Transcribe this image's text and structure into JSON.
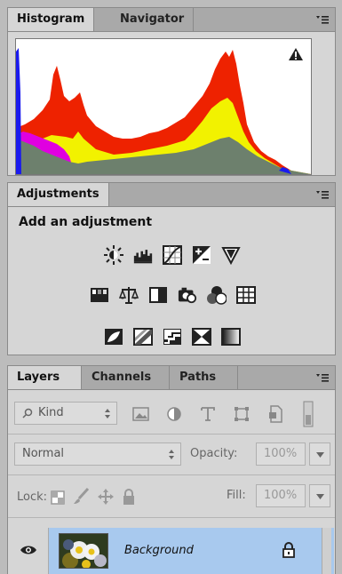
{
  "histogram_panel": {
    "tabs": [
      "Histogram",
      "Navigator"
    ],
    "active_tab": "Histogram",
    "menu_icon": "panel-menu-icon",
    "warning_icon": "warning-triangle-icon"
  },
  "adjustments_panel": {
    "tab": "Adjustments",
    "heading": "Add an adjustment",
    "rows": [
      [
        "brightness-contrast-icon",
        "levels-icon",
        "curves-icon",
        "exposure-icon",
        "vibrance-icon"
      ],
      [
        "hue-saturation-icon",
        "color-balance-icon",
        "black-white-icon",
        "photo-filter-icon",
        "channel-mixer-icon",
        "color-lookup-icon"
      ],
      [
        "invert-icon",
        "posterize-icon",
        "threshold-icon",
        "selective-color-icon",
        "gradient-map-icon"
      ]
    ]
  },
  "layers_panel": {
    "tabs": [
      "Layers",
      "Channels",
      "Paths"
    ],
    "active_tab": "Layers",
    "filter": {
      "label": "Kind"
    },
    "blend_mode": "Normal",
    "opacity_label": "Opacity:",
    "opacity_value": "100%",
    "lock_label": "Lock:",
    "fill_label": "Fill:",
    "fill_value": "100%",
    "layers": [
      {
        "name": "Background",
        "visible": true,
        "locked": true
      }
    ]
  },
  "colors": {
    "selection": "#a8c9ee",
    "histogram_red": "#ee2200",
    "histogram_yellow": "#f2f200",
    "histogram_magenta": "#e000e0",
    "histogram_gray": "#6d806d",
    "histogram_blue": "#1a1aee"
  }
}
